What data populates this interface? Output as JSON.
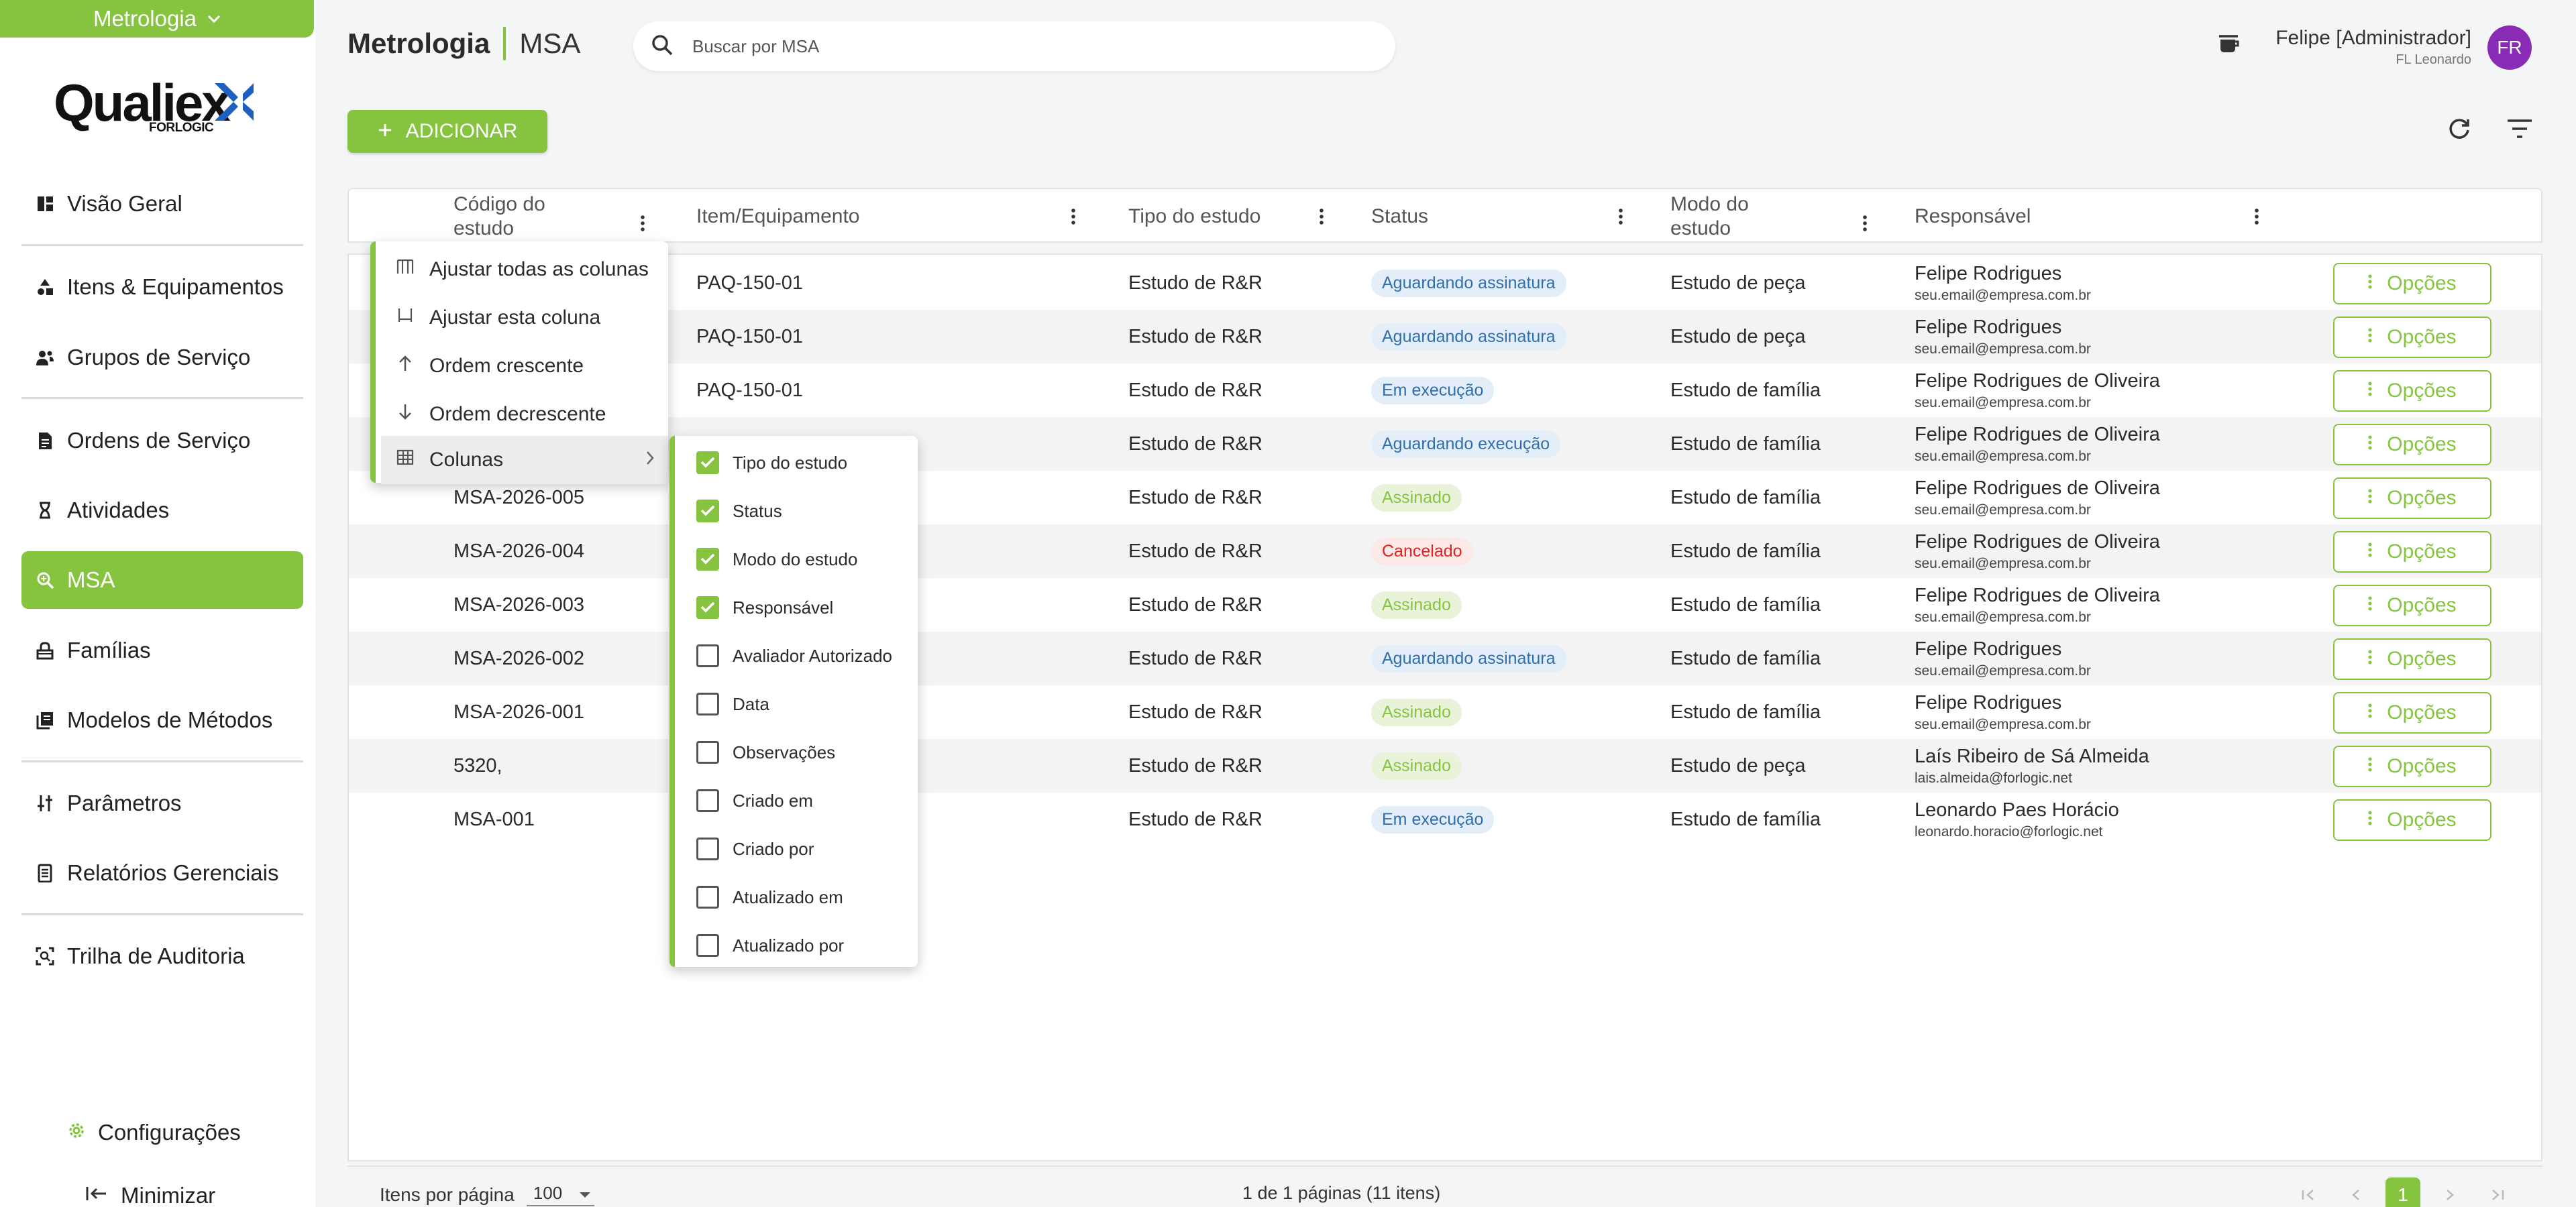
{
  "module_switch": {
    "label": "Metrologia",
    "icon": "chevron-down-icon"
  },
  "logo": {
    "wordmark": "Qualiex",
    "sub": "FORLOGIC"
  },
  "sidebar": {
    "items": [
      {
        "label": "Visão Geral",
        "icon": "dashboard-icon"
      },
      {
        "label": "Itens & Equipamentos",
        "icon": "shapes-icon"
      },
      {
        "label": "Grupos de Serviço",
        "icon": "group-icon"
      },
      {
        "label": "Ordens de Serviço",
        "icon": "document-icon"
      },
      {
        "label": "Atividades",
        "icon": "hourglass-icon"
      },
      {
        "label": "MSA",
        "icon": "search-zoom-icon",
        "active": true
      },
      {
        "label": "Famílias",
        "icon": "family-icon"
      },
      {
        "label": "Modelos de Métodos",
        "icon": "library-icon"
      },
      {
        "label": "Parâmetros",
        "icon": "sliders-icon"
      },
      {
        "label": "Relatórios Gerenciais",
        "icon": "report-icon"
      },
      {
        "label": "Trilha de Auditoria",
        "icon": "audit-icon"
      }
    ],
    "config": "Configurações",
    "minimize": "Minimizar"
  },
  "header": {
    "title_bold": "Metrologia",
    "title_module": "MSA",
    "search_placeholder": "Buscar por MSA",
    "user_name": "Felipe [Administrador]",
    "user_org": "FL Leonardo",
    "avatar_initials": "FR"
  },
  "toolbar": {
    "add_label": "ADICIONAR"
  },
  "table": {
    "columns": [
      {
        "label": "Código do estudo"
      },
      {
        "label": "Item/Equipamento"
      },
      {
        "label": "Tipo do estudo"
      },
      {
        "label": "Status"
      },
      {
        "label": "Modo do estudo"
      },
      {
        "label": "Responsável"
      }
    ],
    "options_label": "Opções",
    "rows": [
      {
        "code": "",
        "item": "PAQ-150-01",
        "type": "Estudo de R&R",
        "status": "Aguardando assinatura",
        "status_kind": "blue",
        "mode": "Estudo de peça",
        "resp_name": "Felipe Rodrigues",
        "resp_email": "seu.email@empresa.com.br"
      },
      {
        "code": "",
        "item": "PAQ-150-01",
        "type": "Estudo de R&R",
        "status": "Aguardando assinatura",
        "status_kind": "blue",
        "mode": "Estudo de peça",
        "resp_name": "Felipe Rodrigues",
        "resp_email": "seu.email@empresa.com.br"
      },
      {
        "code": "",
        "item": "PAQ-150-01",
        "type": "Estudo de R&R",
        "status": "Em execução",
        "status_kind": "blue",
        "mode": "Estudo de família",
        "resp_name": "Felipe Rodrigues de Oliveira",
        "resp_email": "seu.email@empresa.com.br"
      },
      {
        "code": "",
        "item": "",
        "type": "Estudo de R&R",
        "status": "Aguardando execução",
        "status_kind": "blue",
        "mode": "Estudo de família",
        "resp_name": "Felipe Rodrigues de Oliveira",
        "resp_email": "seu.email@empresa.com.br"
      },
      {
        "code": "MSA-2026-005",
        "item": "",
        "type": "Estudo de R&R",
        "status": "Assinado",
        "status_kind": "green",
        "mode": "Estudo de família",
        "resp_name": "Felipe Rodrigues de Oliveira",
        "resp_email": "seu.email@empresa.com.br"
      },
      {
        "code": "MSA-2026-004",
        "item": "",
        "type": "Estudo de R&R",
        "status": "Cancelado",
        "status_kind": "red",
        "mode": "Estudo de família",
        "resp_name": "Felipe Rodrigues de Oliveira",
        "resp_email": "seu.email@empresa.com.br"
      },
      {
        "code": "MSA-2026-003",
        "item": "",
        "type": "Estudo de R&R",
        "status": "Assinado",
        "status_kind": "green",
        "mode": "Estudo de família",
        "resp_name": "Felipe Rodrigues de Oliveira",
        "resp_email": "seu.email@empresa.com.br"
      },
      {
        "code": "MSA-2026-002",
        "item": "",
        "type": "Estudo de R&R",
        "status": "Aguardando assinatura",
        "status_kind": "blue",
        "mode": "Estudo de família",
        "resp_name": "Felipe Rodrigues",
        "resp_email": "seu.email@empresa.com.br"
      },
      {
        "code": "MSA-2026-001",
        "item": "",
        "type": "Estudo de R&R",
        "status": "Assinado",
        "status_kind": "green",
        "mode": "Estudo de família",
        "resp_name": "Felipe Rodrigues",
        "resp_email": "seu.email@empresa.com.br"
      },
      {
        "code": "5320,",
        "item": "",
        "type": "Estudo de R&R",
        "status": "Assinado",
        "status_kind": "green",
        "mode": "Estudo de peça",
        "resp_name": "Laís Ribeiro de Sá Almeida",
        "resp_email": "lais.almeida@forlogic.net"
      },
      {
        "code": "MSA-001",
        "item": "",
        "type": "Estudo de R&R",
        "status": "Em execução",
        "status_kind": "blue",
        "mode": "Estudo de família",
        "resp_name": "Leonardo Paes Horácio",
        "resp_email": "leonardo.horacio@forlogic.net"
      }
    ]
  },
  "footer": {
    "items_per_page_label": "Itens por página",
    "items_per_page_value": "100",
    "page_info": "1 de 1 páginas (11 itens)",
    "current_page": "1"
  },
  "context_menu": {
    "items": [
      {
        "label": "Ajustar todas as colunas",
        "icon": "fit-all-columns-icon"
      },
      {
        "label": "Ajustar esta coluna",
        "icon": "fit-column-icon"
      },
      {
        "label": "Ordem crescente",
        "icon": "arrow-up-icon"
      },
      {
        "label": "Ordem decrescente",
        "icon": "arrow-down-icon"
      },
      {
        "label": "Colunas",
        "icon": "table-icon",
        "has_submenu": true
      }
    ]
  },
  "columns_menu": {
    "items": [
      {
        "label": "Tipo do estudo",
        "checked": true
      },
      {
        "label": "Status",
        "checked": true
      },
      {
        "label": "Modo do estudo",
        "checked": true
      },
      {
        "label": "Responsável",
        "checked": true
      },
      {
        "label": "Avaliador Autorizado",
        "checked": false
      },
      {
        "label": "Data",
        "checked": false
      },
      {
        "label": "Observações",
        "checked": false
      },
      {
        "label": "Criado em",
        "checked": false
      },
      {
        "label": "Criado por",
        "checked": false
      },
      {
        "label": "Atualizado em",
        "checked": false
      },
      {
        "label": "Atualizado por",
        "checked": false
      }
    ]
  },
  "colors": {
    "accent": "#86c440",
    "avatar": "#8a2bb5",
    "chip_blue_bg": "#e3eef9",
    "chip_blue_fg": "#2f6fb0",
    "chip_green_bg": "#e8f3d9",
    "chip_green_fg": "#86c440",
    "chip_red_bg": "#fde8e8",
    "chip_red_fg": "#e02424"
  }
}
